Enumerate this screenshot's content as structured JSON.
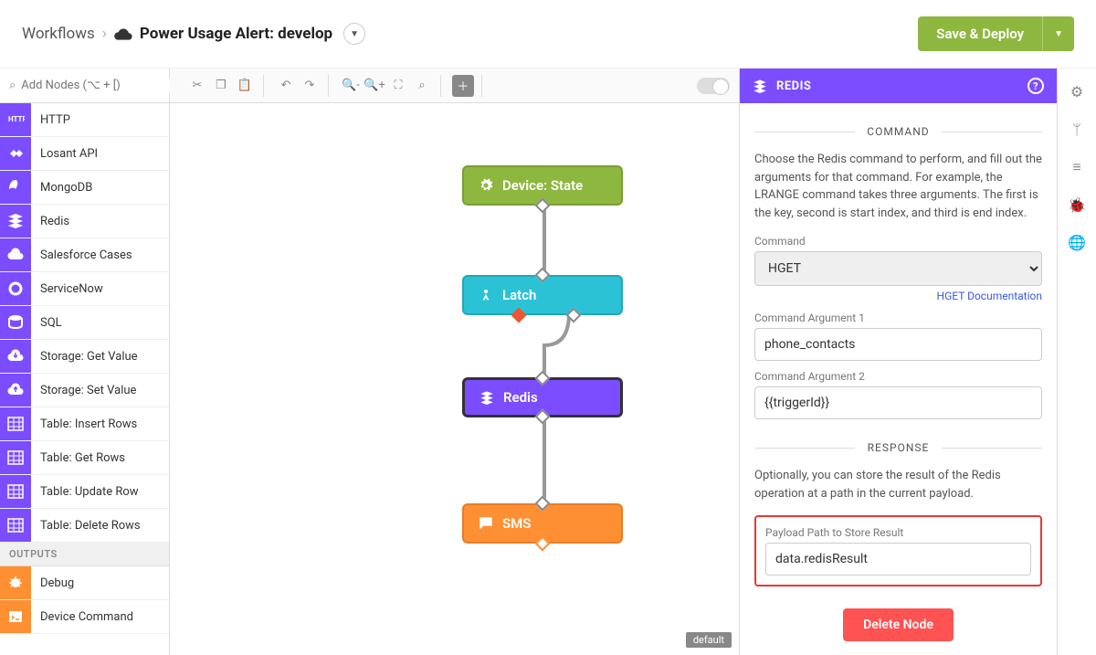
{
  "header": {
    "breadcrumb_root": "Workflows",
    "chevron": "›",
    "title": "Power Usage Alert: develop",
    "save_label": "Save & Deploy"
  },
  "search": {
    "placeholder": "Add Nodes (⌥ + [)"
  },
  "nodes": [
    {
      "label": "HTTP",
      "color": "purple",
      "icon": "http"
    },
    {
      "label": "Losant API",
      "color": "purple",
      "icon": "link"
    },
    {
      "label": "MongoDB",
      "color": "purple",
      "icon": "leaf"
    },
    {
      "label": "Redis",
      "color": "purple",
      "icon": "stack"
    },
    {
      "label": "Salesforce Cases",
      "color": "purple",
      "icon": "cloud"
    },
    {
      "label": "ServiceNow",
      "color": "purple",
      "icon": "ring"
    },
    {
      "label": "SQL",
      "color": "purple",
      "icon": "db"
    },
    {
      "label": "Storage: Get Value",
      "color": "purple",
      "icon": "clouddn"
    },
    {
      "label": "Storage: Set Value",
      "color": "purple",
      "icon": "cloudup"
    },
    {
      "label": "Table: Insert Rows",
      "color": "purple",
      "icon": "table"
    },
    {
      "label": "Table: Get Rows",
      "color": "purple",
      "icon": "table"
    },
    {
      "label": "Table: Update Row",
      "color": "purple",
      "icon": "table"
    },
    {
      "label": "Table: Delete Rows",
      "color": "purple",
      "icon": "table"
    }
  ],
  "outputs_header": "OUTPUTS",
  "outputs": [
    {
      "label": "Debug",
      "color": "orange",
      "icon": "bug"
    },
    {
      "label": "Device Command",
      "color": "orange",
      "icon": "cmd"
    }
  ],
  "flow": {
    "device": "Device: State",
    "latch": "Latch",
    "redis": "Redis",
    "sms": "SMS"
  },
  "default_badge": "default",
  "panel": {
    "title": "REDIS",
    "command_section": "COMMAND",
    "command_desc": "Choose the Redis command to perform, and fill out the arguments for that command. For example, the LRANGE command takes three arguments. The first is the key, second is start index, and third is end index.",
    "command_label": "Command",
    "command_value": "HGET",
    "doc_link": "HGET Documentation",
    "arg1_label": "Command Argument 1",
    "arg1_value": "phone_contacts",
    "arg2_label": "Command Argument 2",
    "arg2_value": "{{triggerId}}",
    "response_section": "RESPONSE",
    "response_desc": "Optionally, you can store the result of the Redis operation at a path in the current payload.",
    "result_label": "Payload Path to Store Result",
    "result_value": "data.redisResult",
    "delete_label": "Delete Node"
  }
}
